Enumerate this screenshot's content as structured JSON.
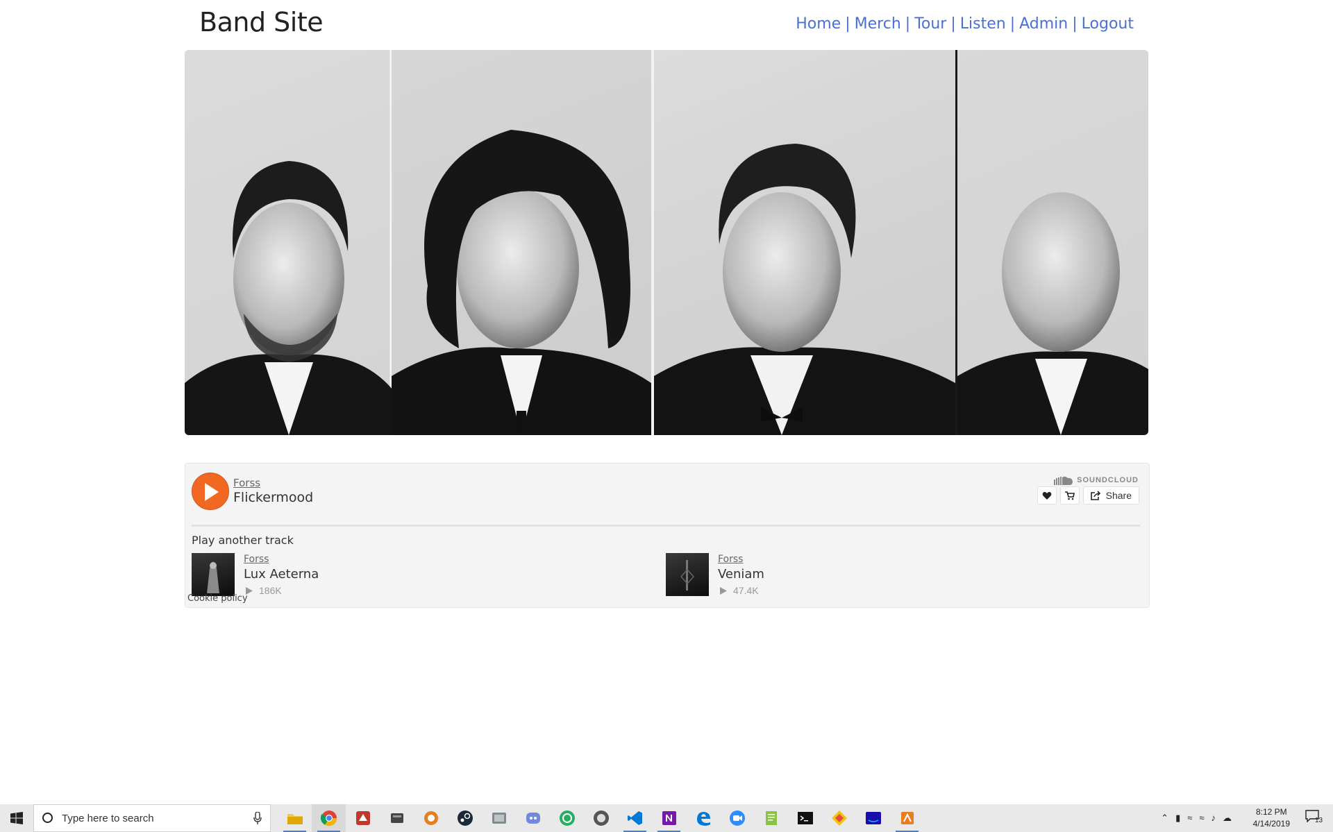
{
  "header": {
    "brand": "Band Site",
    "nav": [
      {
        "label": "Home"
      },
      {
        "label": "Merch"
      },
      {
        "label": "Tour"
      },
      {
        "label": "Listen"
      },
      {
        "label": "Admin"
      },
      {
        "label": "Logout"
      }
    ],
    "separator": "|",
    "link_color": "#4a6fd6"
  },
  "hero": {
    "image": "band-photo",
    "style": "black-and-white"
  },
  "player": {
    "brand": "SOUNDCLOUD",
    "accent": "#f26722",
    "artist": "Forss",
    "track": "Flickermood",
    "share_label": "Share",
    "play_another_label": "Play another track",
    "recommendations": [
      {
        "artist": "Forss",
        "title": "Lux Aeterna",
        "plays": "186K"
      },
      {
        "artist": "Forss",
        "title": "Veniam",
        "plays": "47.4K"
      }
    ],
    "cookie_label": "Cookie policy"
  },
  "taskbar": {
    "search_placeholder": "Type here to search",
    "apps": [
      "file-explorer",
      "chrome",
      "app",
      "app",
      "app",
      "steam",
      "app",
      "discord",
      "app",
      "app",
      "vscode",
      "onenote",
      "edge",
      "zoom",
      "notepad",
      "terminal",
      "app",
      "amazon-music",
      "app"
    ],
    "time": "8:12 PM",
    "date": "4/14/2019",
    "notifications": "13"
  }
}
